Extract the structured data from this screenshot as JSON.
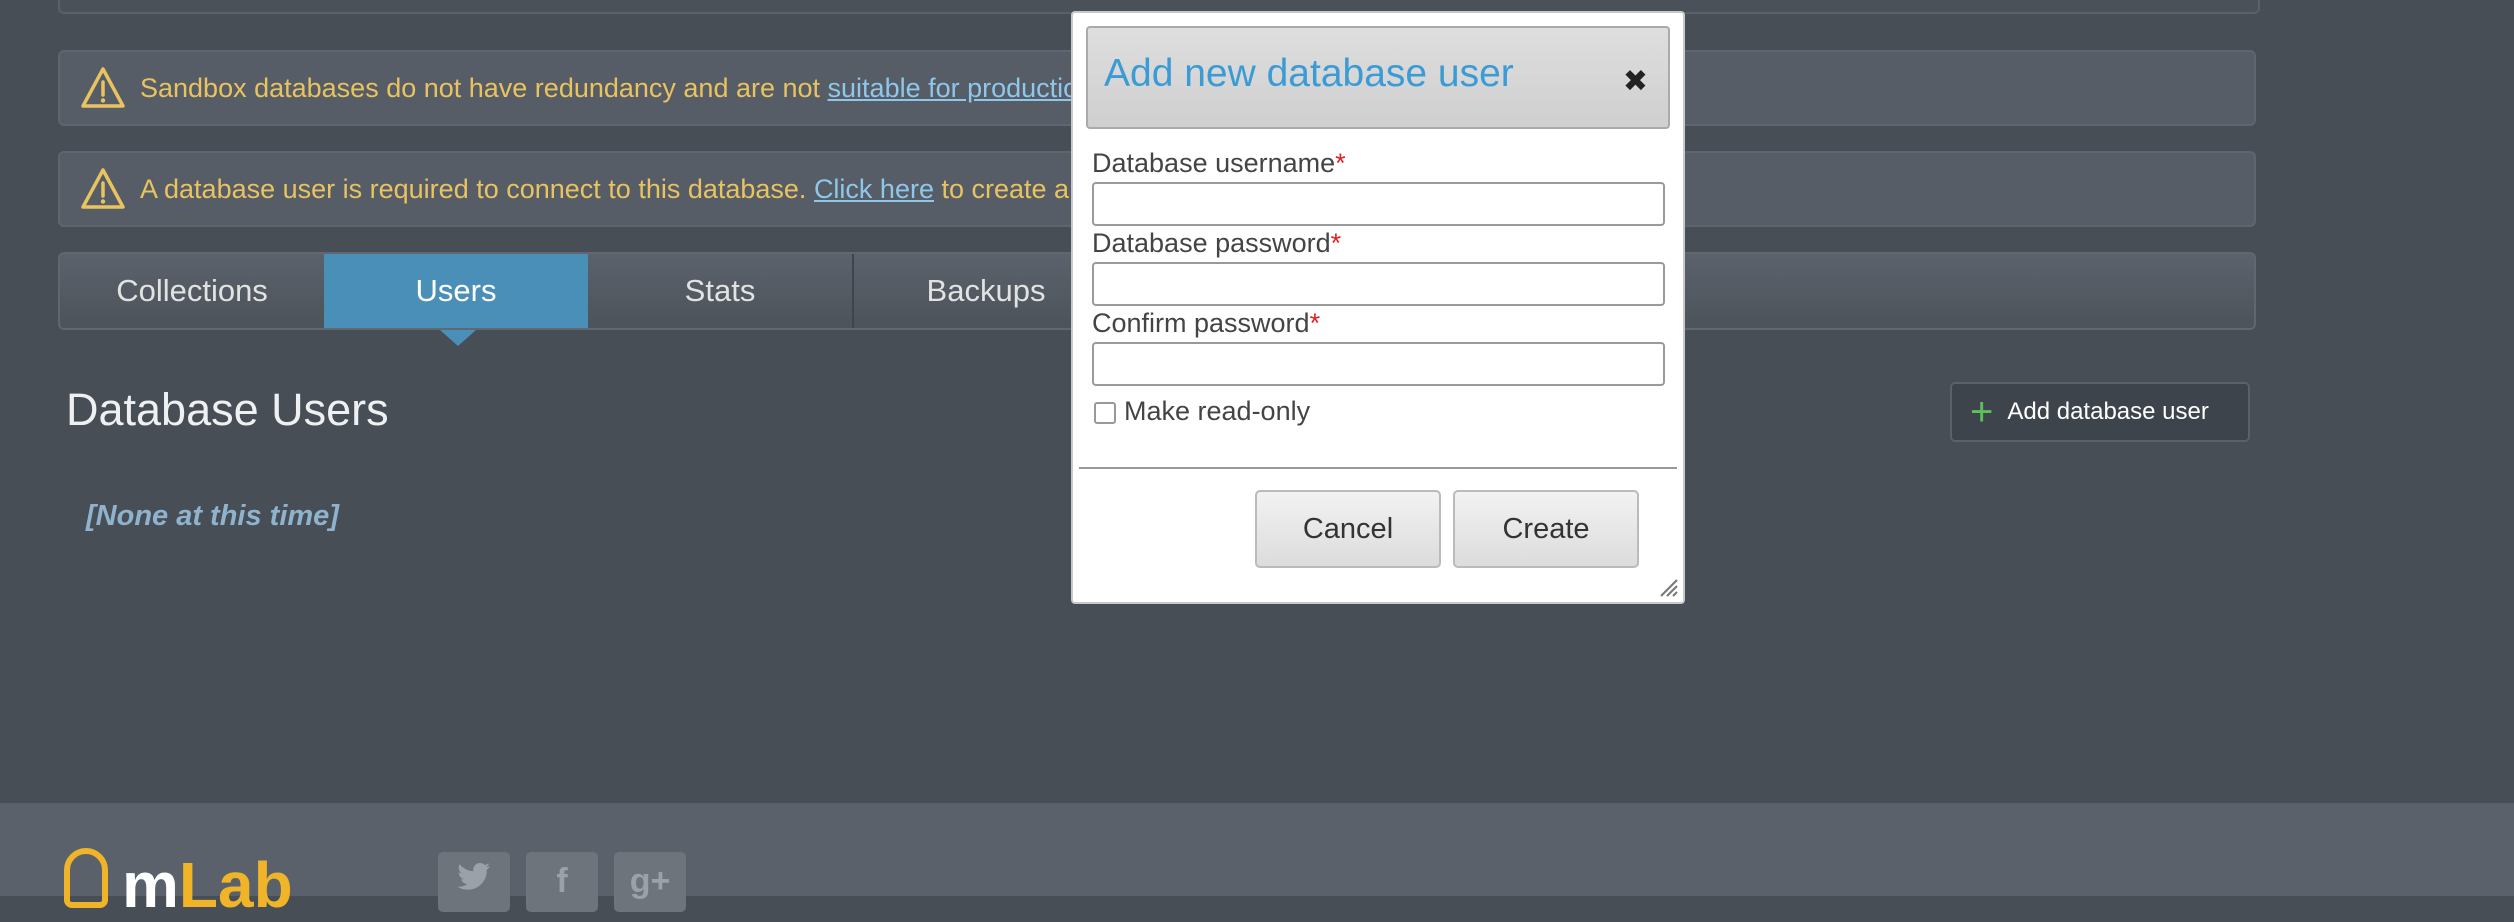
{
  "alerts": {
    "sandbox": {
      "text_before": "Sandbox databases do not have redundancy and are not ",
      "link": "suitable for production",
      "text_after": "."
    },
    "user_required": {
      "text_before": "A database user is required to connect to this database. ",
      "link": "Click here",
      "text_after": " to create a new"
    }
  },
  "tabs": [
    {
      "label": "Collections"
    },
    {
      "label": "Users",
      "active": true
    },
    {
      "label": "Stats"
    },
    {
      "label": "Backups"
    }
  ],
  "section": {
    "title": "Database Users",
    "empty_note": "[None at this time]",
    "add_button_label": "Add database user"
  },
  "dialog": {
    "title": "Add new database user",
    "close_symbol": "✖",
    "fields": [
      {
        "label": "Database username",
        "required_mark": "*",
        "value": ""
      },
      {
        "label": "Database password",
        "required_mark": "*",
        "value": ""
      },
      {
        "label": "Confirm password",
        "required_mark": "*",
        "value": ""
      }
    ],
    "readonly_checkbox": {
      "label": "Make read-only",
      "checked": false
    },
    "cancel_label": "Cancel",
    "create_label": "Create"
  },
  "footer": {
    "logo_m": "m",
    "logo_lab": "Lab",
    "social": [
      {
        "icon": "twitter-icon"
      },
      {
        "icon": "facebook-icon",
        "glyph": "f"
      },
      {
        "icon": "google-plus-icon",
        "glyph": "g+"
      }
    ]
  },
  "colors": {
    "background": "#474e56",
    "alert_text": "#e8c360",
    "link": "#8fc7ea",
    "active_tab": "#4a8fb8",
    "dialog_title": "#3a9bd5",
    "required": "#e02020"
  }
}
